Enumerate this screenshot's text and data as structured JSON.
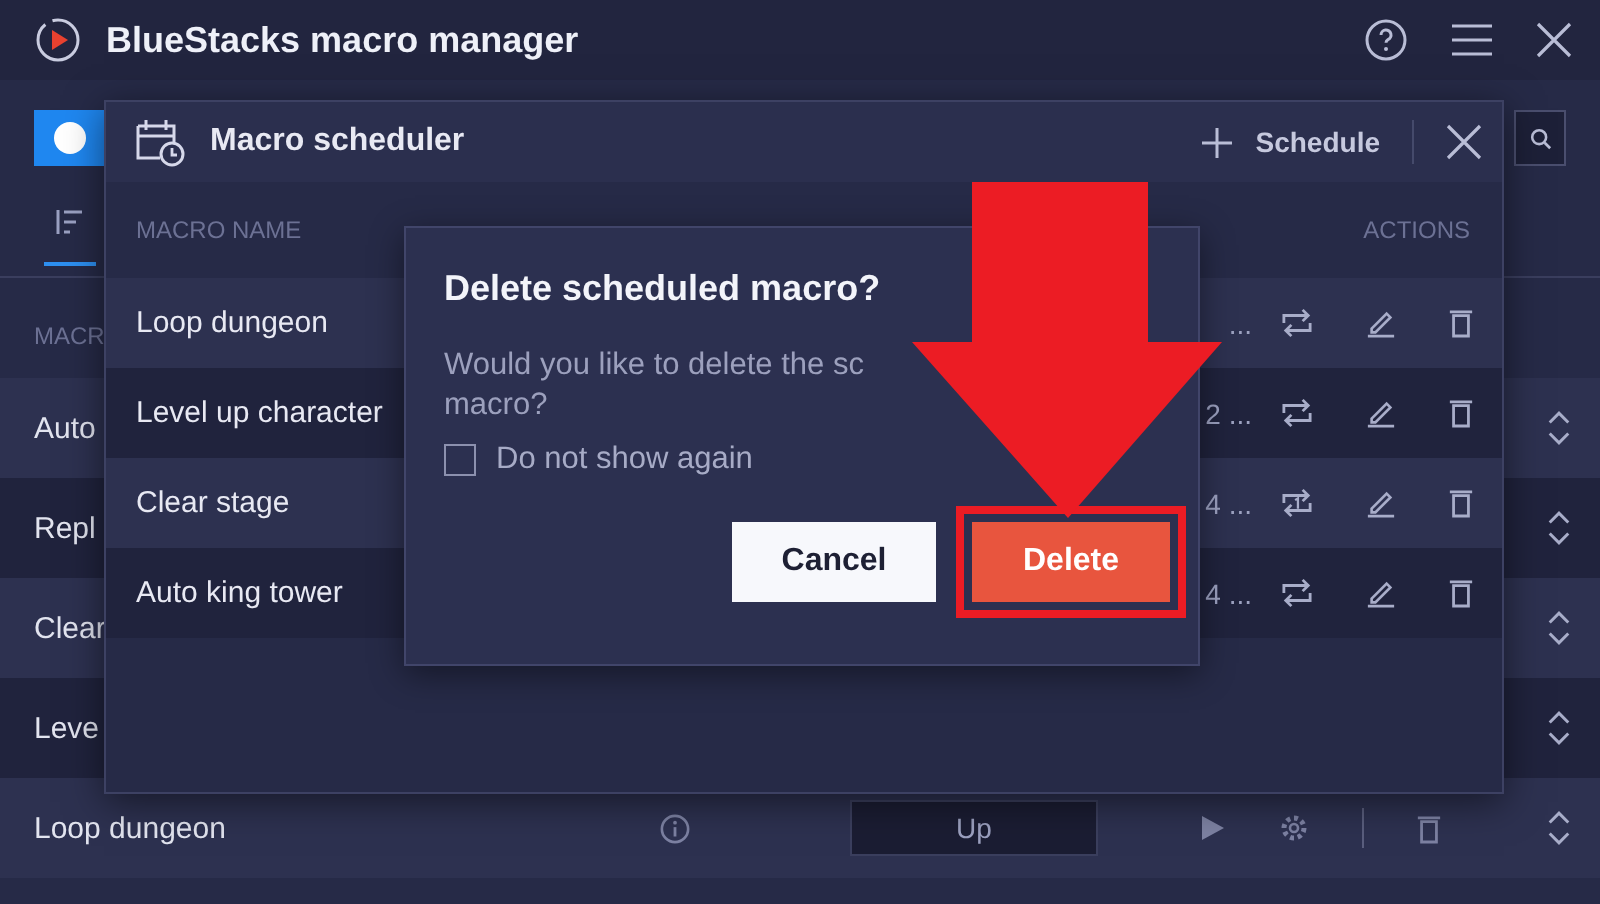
{
  "window": {
    "title": "BlueStacks macro manager"
  },
  "toolbar": {
    "toggle_on": true
  },
  "list": {
    "header": "MACR",
    "rows": [
      {
        "name": "Auto"
      },
      {
        "name": "Repl"
      },
      {
        "name": "Clear"
      },
      {
        "name": "Leve"
      },
      {
        "name": "Loop dungeon",
        "field": "Up"
      }
    ]
  },
  "scheduler": {
    "title": "Macro scheduler",
    "schedule_button": "Schedule",
    "columns": [
      "MACRO NAME",
      "ACTIONS"
    ],
    "rows": [
      {
        "name": "Loop dungeon",
        "fragment": "...",
        "kind": "repeat"
      },
      {
        "name": "Level up character",
        "fragment": "2 ...",
        "kind": "repeat"
      },
      {
        "name": "Clear stage",
        "fragment": "4 ...",
        "kind": "repeat-once"
      },
      {
        "name": "Auto king tower",
        "fragment": "4 ...",
        "kind": "repeat"
      }
    ]
  },
  "dialog": {
    "title": "Delete scheduled macro?",
    "message_lines": [
      "Would you like to delete the sc",
      "macro?"
    ],
    "checkbox": {
      "label": "Do not show again",
      "checked": false
    },
    "buttons": [
      {
        "label": "Cancel",
        "kind": "secondary"
      },
      {
        "label": "Delete",
        "kind": "danger"
      }
    ]
  }
}
